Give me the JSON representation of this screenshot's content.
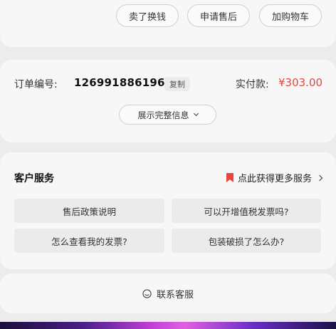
{
  "actions": {
    "sell_label": "卖了换钱",
    "aftersale_label": "申请售后",
    "addcart_label": "加购物车"
  },
  "order": {
    "number_label": "订单编号:",
    "number": "126991886196",
    "copy_label": "复制",
    "paid_label": "实付款:",
    "paid_value": "¥303.00",
    "expand_label": "展示完整信息"
  },
  "service": {
    "title": "客户服务",
    "more_label": "点此获得更多服务",
    "faqs": [
      "售后政策说明",
      "可以开增值税发票吗?",
      "怎么查看我的发票?",
      "包装破损了怎么办?"
    ]
  },
  "contact": {
    "label": "联系客服"
  },
  "colors": {
    "accent_red": "#e8463a",
    "card_bg": "#f7f7f7",
    "page_bg": "#ececec"
  }
}
